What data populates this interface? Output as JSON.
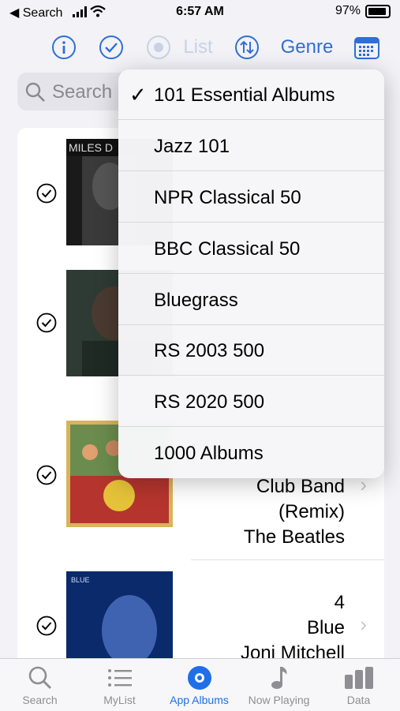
{
  "status_bar": {
    "back_label": "◀ Search",
    "time": "6:57 AM",
    "battery": "97%"
  },
  "toolbar": {
    "list_label": "List",
    "genre_label": "Genre",
    "icons": [
      "info-icon",
      "checkmark-circle-icon",
      "record-circle-icon",
      "sort-arrows-icon",
      "calendar-icon"
    ]
  },
  "search": {
    "placeholder": "Search"
  },
  "albums": [
    {
      "lines": []
    },
    {
      "lines": []
    },
    {
      "lines": [
        "Club Band",
        "(Remix)",
        "The Beatles"
      ]
    },
    {
      "lines": [
        "4",
        "Blue",
        "Joni Mitchell"
      ]
    }
  ],
  "menu": {
    "items": [
      {
        "label": "101 Essential Albums",
        "checked": true
      },
      {
        "label": "Jazz 101",
        "checked": false
      },
      {
        "label": "NPR Classical 50",
        "checked": false
      },
      {
        "label": "BBC Classical 50",
        "checked": false
      },
      {
        "label": "Bluegrass",
        "checked": false
      },
      {
        "label": "RS 2003 500",
        "checked": false
      },
      {
        "label": "RS 2020 500",
        "checked": false
      },
      {
        "label": "1000 Albums",
        "checked": false
      }
    ],
    "check_glyph": "✓"
  },
  "tabs": [
    {
      "label": "Search",
      "icon": "search-icon",
      "active": false
    },
    {
      "label": "MyList",
      "icon": "list-icon",
      "active": false
    },
    {
      "label": "App Albums",
      "icon": "record-circle-icon",
      "active": true
    },
    {
      "label": "Now Playing",
      "icon": "music-note-icon",
      "active": false
    },
    {
      "label": "Data",
      "icon": "bar-chart-icon",
      "active": false
    }
  ],
  "colors": {
    "accent": "#2f6fd6",
    "tab_active": "#1e6fe8",
    "inactive": "#8e8e93"
  }
}
